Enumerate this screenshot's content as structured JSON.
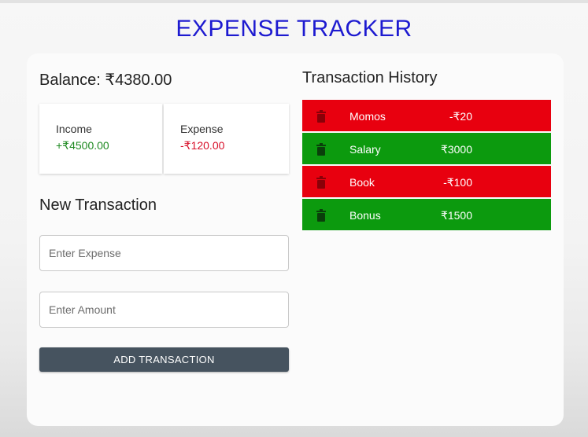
{
  "title": "EXPENSE TRACKER",
  "balance": {
    "text": "Balance: ₹4380.00"
  },
  "summary": {
    "income_label": "Income",
    "income_value": "+₹4500.00",
    "expense_label": "Expense",
    "expense_value": "-₹120.00"
  },
  "new_transaction": {
    "heading": "New Transaction",
    "expense_placeholder": "Enter Expense",
    "expense_value": "",
    "amount_placeholder": "Enter Amount",
    "amount_value": "",
    "button_label": "ADD TRANSACTION"
  },
  "history": {
    "heading": "Transaction History",
    "transactions": [
      {
        "name": "Momos",
        "amount": "-₹20",
        "kind": "expense",
        "icon": "trash-icon"
      },
      {
        "name": "Salary",
        "amount": "₹3000",
        "kind": "income",
        "icon": "trash-icon"
      },
      {
        "name": "Book",
        "amount": "-₹100",
        "kind": "expense",
        "icon": "trash-icon"
      },
      {
        "name": "Bonus",
        "amount": "₹1500",
        "kind": "income",
        "icon": "trash-icon"
      }
    ]
  },
  "colors": {
    "title": "#1d1ad0",
    "income_text": "#1f8a22",
    "expense_text": "#d8102a",
    "expense_row": "#e8000f",
    "income_row": "#0c9a0e",
    "button": "#46535f"
  }
}
